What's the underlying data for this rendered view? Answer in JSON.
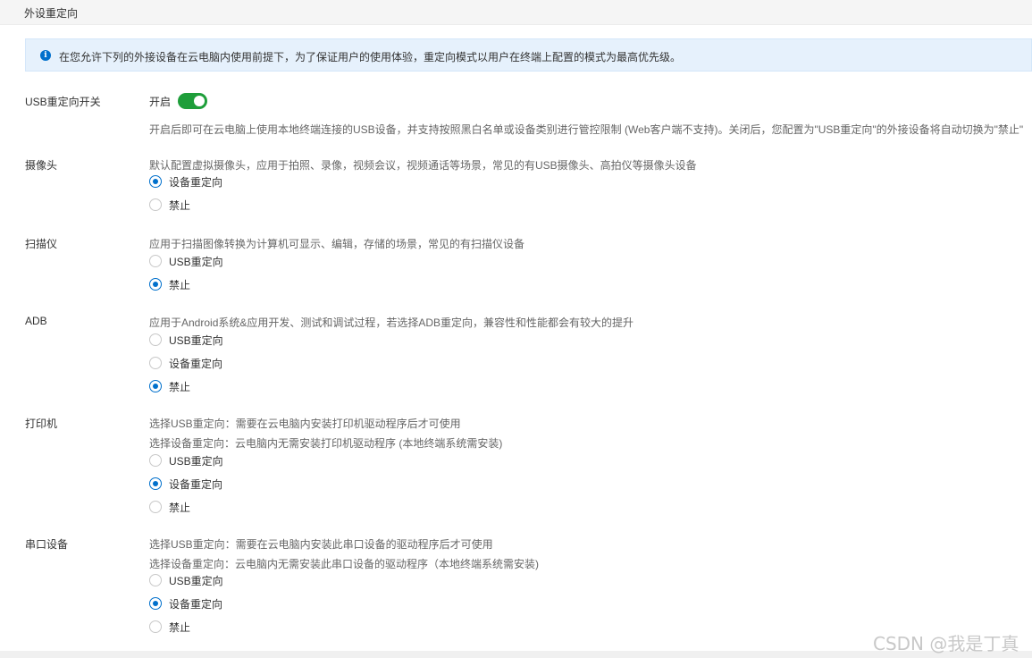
{
  "header": {
    "title": "外设重定向"
  },
  "notice": {
    "icon": "info-icon",
    "text": "在您允许下列的外接设备在云电脑内使用前提下，为了保证用户的使用体验，重定向模式以用户在终端上配置的模式为最高优先级。"
  },
  "usb_switch": {
    "label": "USB重定向开关",
    "state_text": "开启",
    "enabled": true,
    "accent_color": "#1e9e3a",
    "description": "开启后即可在云电脑上使用本地终端连接的USB设备，并支持按照黑白名单或设备类别进行管控限制 (Web客户端不支持)。关闭后，您配置为\"USB重定向\"的外接设备将自动切换为\"禁止\""
  },
  "camera": {
    "label": "摄像头",
    "description": "默认配置虚拟摄像头，应用于拍照、录像，视频会议，视频通话等场景，常见的有USB摄像头、高拍仪等摄像头设备",
    "options": [
      "设备重定向",
      "禁止"
    ],
    "selected": "设备重定向"
  },
  "scanner": {
    "label": "扫描仪",
    "description": "应用于扫描图像转换为计算机可显示、编辑，存储的场景，常见的有扫描仪设备",
    "options": [
      "USB重定向",
      "禁止"
    ],
    "selected": "禁止"
  },
  "adb": {
    "label": "ADB",
    "description": "应用于Android系统&应用开发、测试和调试过程，若选择ADB重定向，兼容性和性能都会有较大的提升",
    "options": [
      "USB重定向",
      "设备重定向",
      "禁止"
    ],
    "selected": "禁止"
  },
  "printer": {
    "label": "打印机",
    "description_1": "选择USB重定向：需要在云电脑内安装打印机驱动程序后才可使用",
    "description_2": "选择设备重定向：云电脑内无需安装打印机驱动程序 (本地终端系统需安装)",
    "options": [
      "USB重定向",
      "设备重定向",
      "禁止"
    ],
    "selected": "设备重定向"
  },
  "serial": {
    "label": "串口设备",
    "description_1": "选择USB重定向：需要在云电脑内安装此串口设备的驱动程序后才可使用",
    "description_2": "选择设备重定向：云电脑内无需安装此串口设备的驱动程序（本地终端系统需安装)",
    "options": [
      "USB重定向",
      "设备重定向",
      "禁止"
    ],
    "selected": "设备重定向"
  },
  "colors": {
    "primary": "#0070cc",
    "notice_bg": "#e6f1fc"
  },
  "watermark": "CSDN @我是丁真"
}
